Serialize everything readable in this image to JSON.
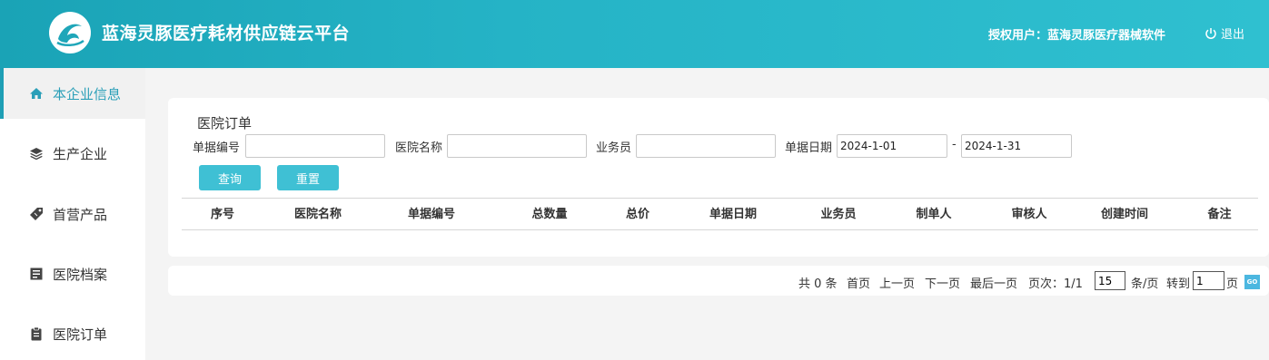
{
  "header": {
    "app_title": "蓝海灵豚医疗耗材供应链云平台",
    "user_info": "授权用户：蓝海灵豚医疗器械软件",
    "logout_label": "退出",
    "colors": {
      "header_start": "#1aa3b6",
      "header_end": "#2fc0d0"
    }
  },
  "sidebar": {
    "items": [
      {
        "label": "本企业信息",
        "icon": "home-icon",
        "active": true
      },
      {
        "label": "生产企业",
        "icon": "layers-icon",
        "active": false
      },
      {
        "label": "首营产品",
        "icon": "tag-icon",
        "active": false
      },
      {
        "label": "医院档案",
        "icon": "archive-icon",
        "active": false
      },
      {
        "label": "医院订单",
        "icon": "clipboard-icon",
        "active": false
      }
    ]
  },
  "panel": {
    "title": "医院订单",
    "filters": {
      "doc_no_label": "单据编号",
      "doc_no_value": "",
      "hospital_label": "医院名称",
      "hospital_value": "",
      "salesperson_label": "业务员",
      "salesperson_value": "",
      "date_label": "单据日期",
      "date_from": "2024-1-01",
      "date_sep": "-",
      "date_to": "2024-1-31"
    },
    "buttons": {
      "query": "查询",
      "reset": "重置"
    },
    "table": {
      "columns": [
        "序号",
        "医院名称",
        "单据编号",
        "总数量",
        "总价",
        "单据日期",
        "业务员",
        "制单人",
        "审核人",
        "创建时间",
        "备注"
      ],
      "rows": []
    },
    "accent": "#3fc0d4"
  },
  "pager": {
    "total": "共 0 条",
    "first": "首页",
    "prev": "上一页",
    "next": "下一页",
    "last": "最后一页",
    "page_info": "页次：1/1",
    "page_size": "15",
    "per_page_label": "条/页",
    "goto_label": "转到",
    "goto_value": "1",
    "page_suffix": "页",
    "go_label": "GO"
  }
}
